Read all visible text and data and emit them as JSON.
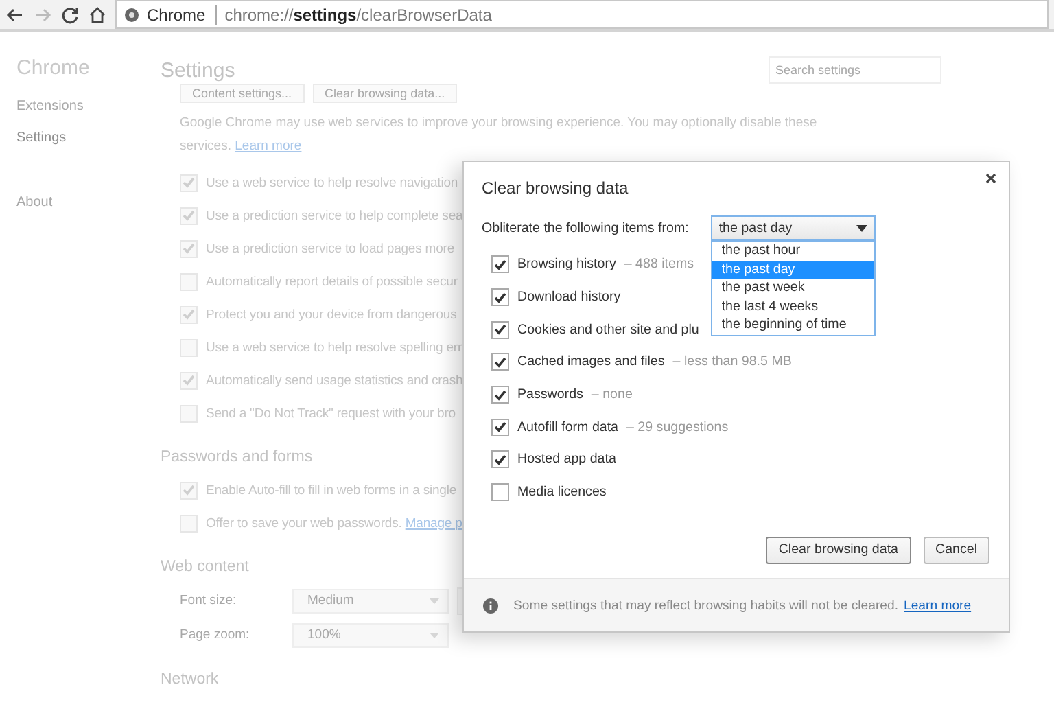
{
  "address_bar": {
    "site_label": "Chrome",
    "url": "chrome://**settings**/clearBrowserData"
  },
  "sidebar": {
    "title": "Chrome",
    "items": [
      {
        "label": "Extensions",
        "selected": false
      },
      {
        "label": "Settings",
        "selected": true
      },
      {
        "label": "About",
        "selected": false
      }
    ]
  },
  "settings": {
    "title": "Settings",
    "search": {
      "placeholder": "Search settings"
    },
    "top_buttons": [
      "Content settings...",
      "Clear browsing data..."
    ],
    "intro": {
      "text": "Google Chrome may use web services to improve your browsing experience. You may optionally disable these services.",
      "link": "Learn more"
    },
    "options": [
      {
        "label": "Use a web service to help resolve navigation",
        "checked": true
      },
      {
        "label": "Use a prediction service to help complete sea",
        "checked": true
      },
      {
        "label": "Use a prediction service to load pages more",
        "checked": true
      },
      {
        "label": "Automatically report details of possible secur",
        "checked": false
      },
      {
        "label": "Protect you and your device from dangerous",
        "checked": true
      },
      {
        "label": "Use a web service to help resolve spelling err",
        "checked": false
      },
      {
        "label": "Automatically send usage statistics and crash",
        "checked": true
      },
      {
        "label": "Send a \"Do Not Track\" request with your bro",
        "checked": false
      }
    ],
    "passwords": {
      "title": "Passwords and forms",
      "options": [
        {
          "label": "Enable Auto-fill to fill in web forms in a single",
          "checked": true
        },
        {
          "label": "Offer to save your web passwords.",
          "checked": false,
          "link": "Manage p"
        }
      ]
    },
    "web_content": {
      "title": "Web content",
      "rows": [
        {
          "label": "Font size:",
          "value": "Medium",
          "extra_box": true
        },
        {
          "label": "Page zoom:",
          "value": "100%",
          "extra_box": false
        }
      ]
    },
    "network": {
      "title": "Network"
    }
  },
  "dialog": {
    "title": "Clear browsing data",
    "range_label": "Obliterate the following items from:",
    "range": {
      "value": "the past day",
      "expanded": true,
      "options": [
        {
          "label": "the past hour",
          "selected": false
        },
        {
          "label": "the past day",
          "selected": true
        },
        {
          "label": "the past week",
          "selected": false
        },
        {
          "label": "the last 4 weeks",
          "selected": false
        },
        {
          "label": "the beginning of time",
          "selected": false
        }
      ]
    },
    "items": [
      {
        "label": "Browsing history",
        "detail": "– 488 items",
        "checked": true
      },
      {
        "label": "Download history",
        "checked": true
      },
      {
        "label": "Cookies and other site and plu",
        "checked": true
      },
      {
        "label": "Cached images and files",
        "detail": "– less than 98.5 MB",
        "checked": true
      },
      {
        "label": "Passwords",
        "detail": "– none",
        "checked": true
      },
      {
        "label": "Autofill form data",
        "detail": "– 29 suggestions",
        "checked": true
      },
      {
        "label": "Hosted app data",
        "checked": true
      },
      {
        "label": "Media licences",
        "checked": false
      }
    ],
    "buttons": [
      {
        "label": "Clear browsing data",
        "primary": true
      },
      {
        "label": "Cancel",
        "primary": false
      }
    ],
    "footer": {
      "text": "Some settings that may reflect browsing habits will not be cleared.",
      "link": "Learn more"
    }
  }
}
